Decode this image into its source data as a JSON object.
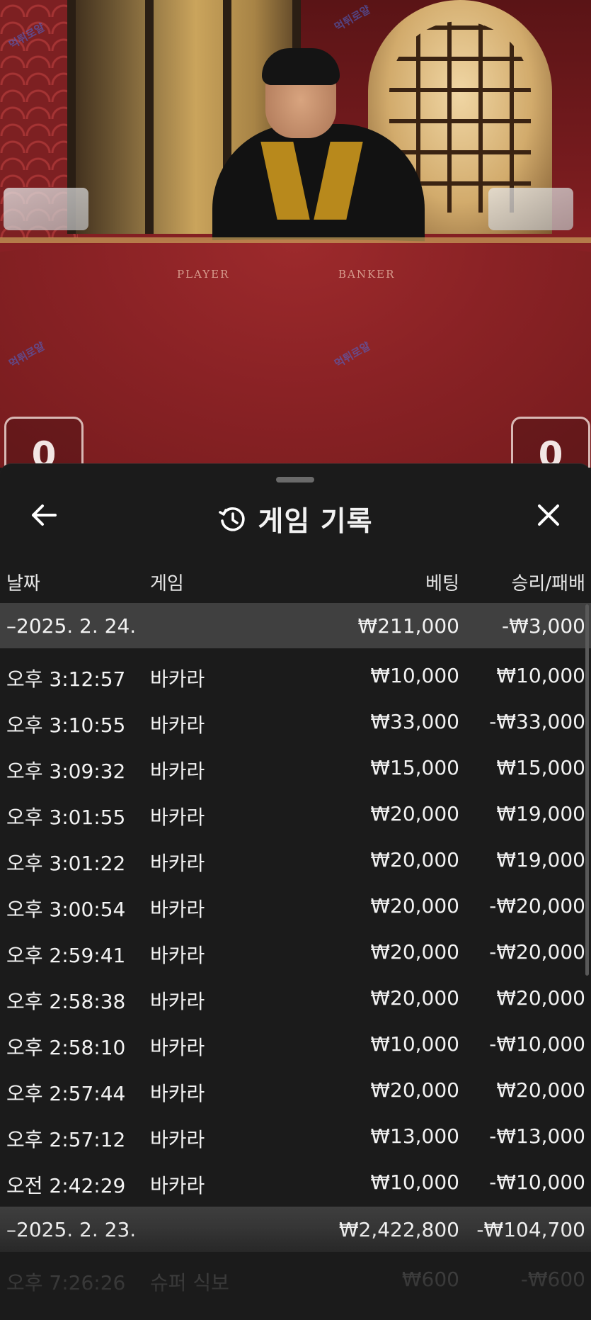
{
  "video": {
    "table_labels": [
      "PLAYER",
      "BANKER"
    ],
    "player_score": "0",
    "banker_score": "0",
    "watermark": "먹튀로얄"
  },
  "sheet": {
    "title": "게임 기록",
    "columns": {
      "date": "날짜",
      "game": "게임",
      "bet": "베팅",
      "win_loss": "승리/패배"
    },
    "groups": [
      {
        "date": "–2025. 2. 24.",
        "bet": "₩211,000",
        "win_loss": "-₩3,000",
        "rows": [
          {
            "time": "오후 3:12:57",
            "game": "바카라",
            "bet": "₩10,000",
            "win_loss": "₩10,000"
          },
          {
            "time": "오후 3:10:55",
            "game": "바카라",
            "bet": "₩33,000",
            "win_loss": "-₩33,000"
          },
          {
            "time": "오후 3:09:32",
            "game": "바카라",
            "bet": "₩15,000",
            "win_loss": "₩15,000"
          },
          {
            "time": "오후 3:01:55",
            "game": "바카라",
            "bet": "₩20,000",
            "win_loss": "₩19,000"
          },
          {
            "time": "오후 3:01:22",
            "game": "바카라",
            "bet": "₩20,000",
            "win_loss": "₩19,000"
          },
          {
            "time": "오후 3:00:54",
            "game": "바카라",
            "bet": "₩20,000",
            "win_loss": "-₩20,000"
          },
          {
            "time": "오후 2:59:41",
            "game": "바카라",
            "bet": "₩20,000",
            "win_loss": "-₩20,000"
          },
          {
            "time": "오후 2:58:38",
            "game": "바카라",
            "bet": "₩20,000",
            "win_loss": "₩20,000"
          },
          {
            "time": "오후 2:58:10",
            "game": "바카라",
            "bet": "₩10,000",
            "win_loss": "-₩10,000"
          },
          {
            "time": "오후 2:57:44",
            "game": "바카라",
            "bet": "₩20,000",
            "win_loss": "₩20,000"
          },
          {
            "time": "오후 2:57:12",
            "game": "바카라",
            "bet": "₩13,000",
            "win_loss": "-₩13,000"
          },
          {
            "time": "오전 2:42:29",
            "game": "바카라",
            "bet": "₩10,000",
            "win_loss": "-₩10,000"
          }
        ]
      },
      {
        "date": "–2025. 2. 23.",
        "bet": "₩2,422,800",
        "win_loss": "-₩104,700",
        "rows": [
          {
            "time": "오후 7:26:26",
            "game": "슈퍼 식보",
            "bet": "₩600",
            "win_loss": "-₩600"
          }
        ]
      }
    ]
  },
  "icons": {
    "back": "arrow-left-icon",
    "history": "history-icon",
    "close": "close-icon"
  },
  "colors": {
    "sheet_bg": "#1b1b1b",
    "group_bg": "#404040",
    "text": "#f2f2f2"
  }
}
